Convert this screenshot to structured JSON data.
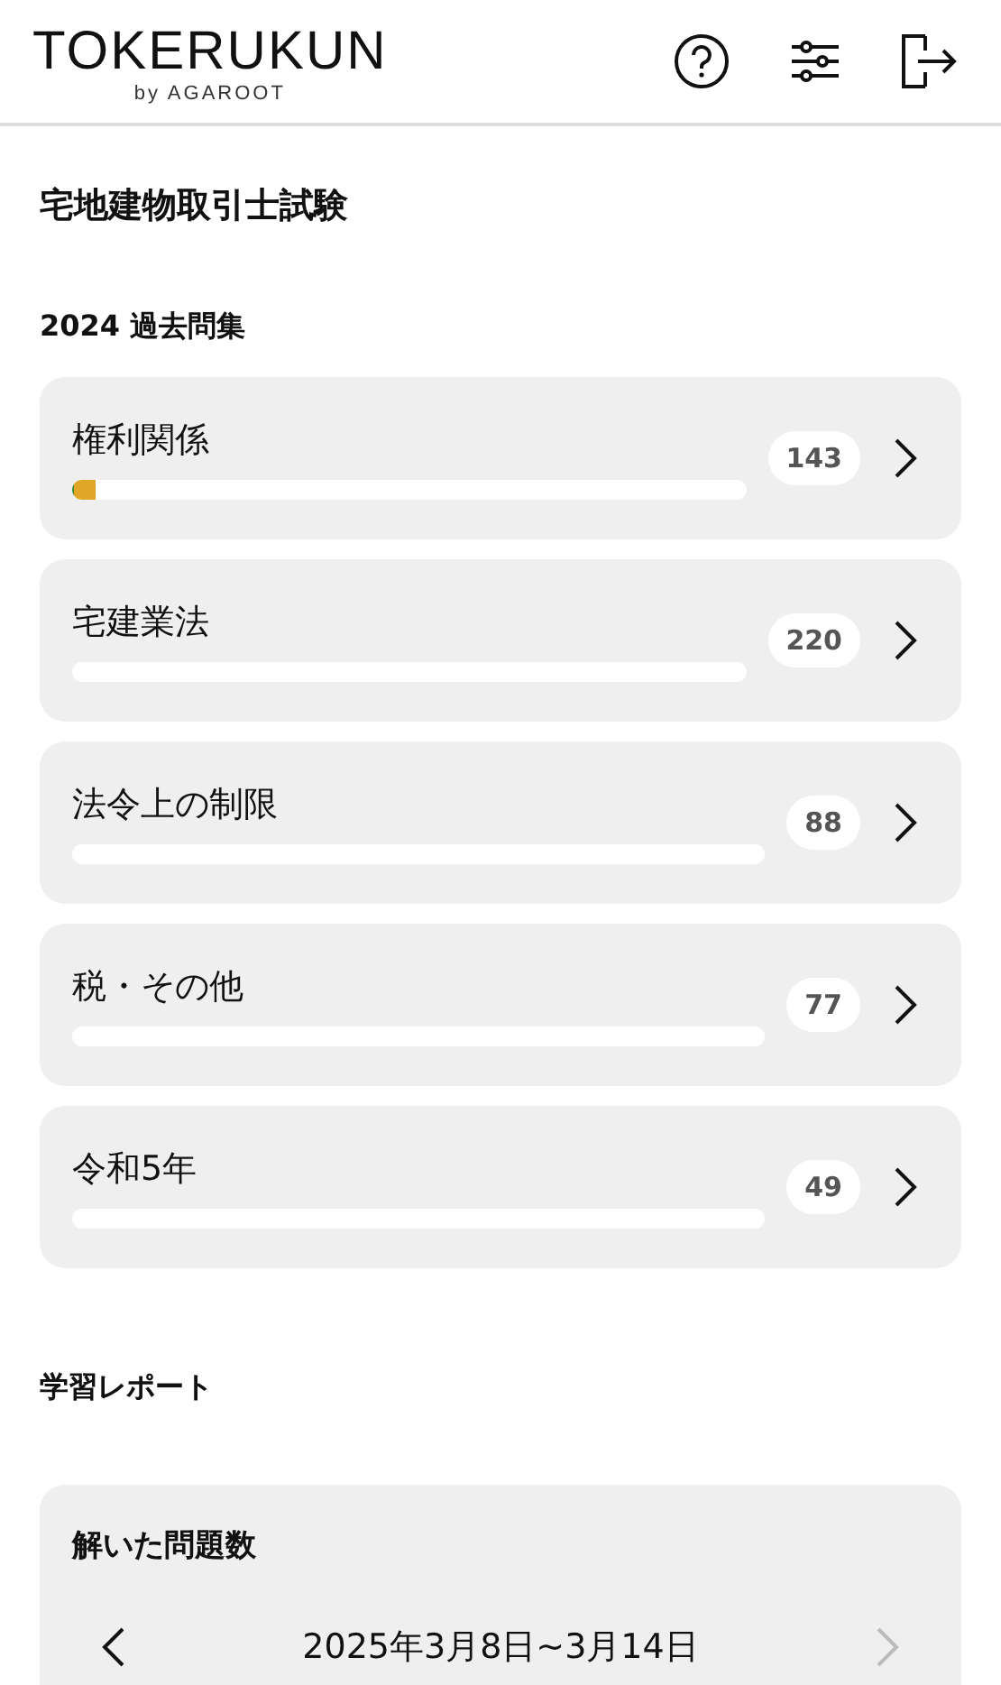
{
  "header": {
    "logo": "TOKERUKUN",
    "logo_sub": "by AGAROOT"
  },
  "page_title": "宅地建物取引士試験",
  "section_title": "2024 過去問集",
  "categories": [
    {
      "name": "権利関係",
      "count": "143",
      "segments": [
        {
          "color": "#3c8c3c",
          "level": 0.004
        },
        {
          "color": "#e0a628",
          "level": 0.03
        }
      ]
    },
    {
      "name": "宅建業法",
      "count": "220"
    },
    {
      "name": "法令上の制限",
      "count": "88"
    },
    {
      "name": "税・その他",
      "count": "77"
    },
    {
      "name": "令和5年",
      "count": "49"
    }
  ],
  "report_title": "学習レポート",
  "report_card": {
    "title": "解いた問題数",
    "period": "2025年3月8日~3月14日",
    "prev_disabled": false,
    "next_disabled": true
  }
}
